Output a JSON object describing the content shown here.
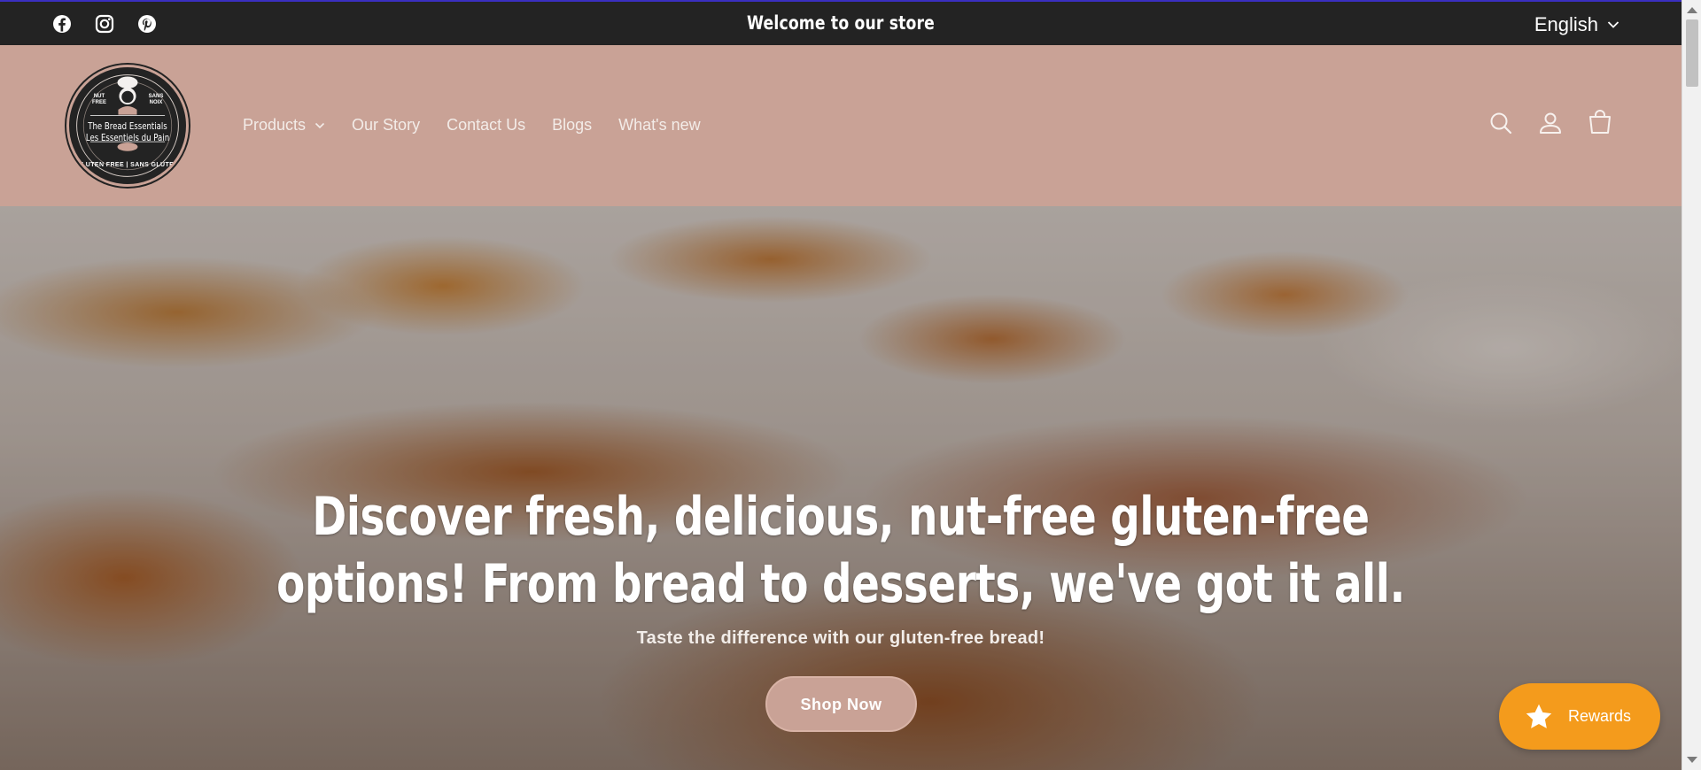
{
  "announcement": {
    "text": "Welcome to our store",
    "language": "English",
    "social_icons": [
      "facebook-icon",
      "instagram-icon",
      "pinterest-icon"
    ]
  },
  "header": {
    "logo": {
      "line1": "The Bread Essentials",
      "line2": "Les Essentiels du Pain",
      "tag_left": "NUT FREE",
      "tag_right": "SANS NOIX",
      "bottom": "GLUTEN FREE | SANS GLUTEN"
    },
    "nav": [
      {
        "label": "Products",
        "has_dropdown": true
      },
      {
        "label": "Our Story"
      },
      {
        "label": "Contact Us"
      },
      {
        "label": "Blogs"
      },
      {
        "label": "What's new"
      }
    ],
    "icons": [
      "search-icon",
      "account-icon",
      "cart-icon"
    ]
  },
  "hero": {
    "title_line1": "Discover fresh, delicious, nut-free gluten-free",
    "title_line2": "options! From bread to desserts, we've got it all.",
    "subtitle": "Taste the difference with our gluten-free bread!",
    "button": "Shop Now"
  },
  "rewards": {
    "label": "Rewards",
    "icon": "star-icon"
  },
  "colors": {
    "announcement_bg": "#232323",
    "header_bg": "#c9a296",
    "button_bg": "#c9a296",
    "rewards_bg": "#f49b1c"
  }
}
